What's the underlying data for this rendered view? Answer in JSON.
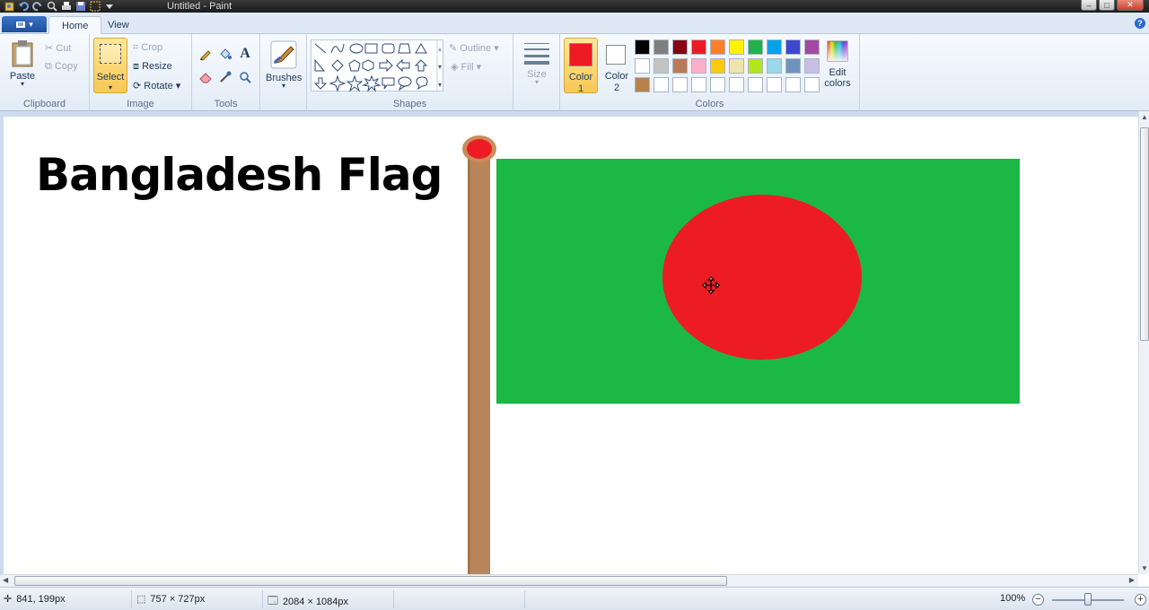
{
  "window": {
    "title": "Untitled - Paint",
    "controls": [
      "minimize",
      "maximize",
      "close"
    ]
  },
  "quick_access": [
    "paint-app-icon",
    "undo-icon",
    "redo-icon",
    "zoom-icon",
    "print-icon",
    "save-icon",
    "select-icon",
    "customize-icon"
  ],
  "tabs": {
    "app_menu": "app-menu",
    "home": "Home",
    "view": "View"
  },
  "ribbon": {
    "clipboard": {
      "label": "Clipboard",
      "paste": "Paste",
      "cut": "Cut",
      "copy": "Copy"
    },
    "image": {
      "label": "Image",
      "select": "Select",
      "crop": "Crop",
      "resize": "Resize",
      "rotate": "Rotate"
    },
    "tools": {
      "label": "Tools"
    },
    "brushes": {
      "label": "Brushes"
    },
    "shapes": {
      "label": "Shapes",
      "outline": "Outline",
      "fill": "Fill"
    },
    "size": {
      "label": "Size"
    },
    "colors": {
      "label": "Colors",
      "color1": "Color",
      "color1_num": "1",
      "color2": "Color",
      "color2_num": "2",
      "edit_colors": "Edit",
      "edit_colors_2": "colors",
      "color1_value": "#ed1c24",
      "color2_value": "#ffffff",
      "palette": [
        "#000000",
        "#7f7f7f",
        "#880015",
        "#ed1c24",
        "#ff7f27",
        "#fff200",
        "#22b14c",
        "#00a2e8",
        "#3f48cc",
        "#a349a4",
        "#ffffff",
        "#c3c3c3",
        "#b97a57",
        "#ffaec9",
        "#ffc90e",
        "#efe4b0",
        "#b5e61d",
        "#99d9ea",
        "#7092be",
        "#c8bfe7",
        "#b5834b",
        "#ffffff",
        "#ffffff",
        "#ffffff",
        "#ffffff",
        "#ffffff",
        "#ffffff",
        "#ffffff",
        "#ffffff",
        "#ffffff"
      ]
    }
  },
  "canvas": {
    "heading": "Bangladesh Flag",
    "flag_green": "#1bb845",
    "flag_red": "#ed1c24",
    "pole_color": "#b8855a"
  },
  "status": {
    "cursor_pos": "841, 199px",
    "selection_size": "757 × 727px",
    "image_size": "2084 × 1084px",
    "zoom": "100%"
  }
}
